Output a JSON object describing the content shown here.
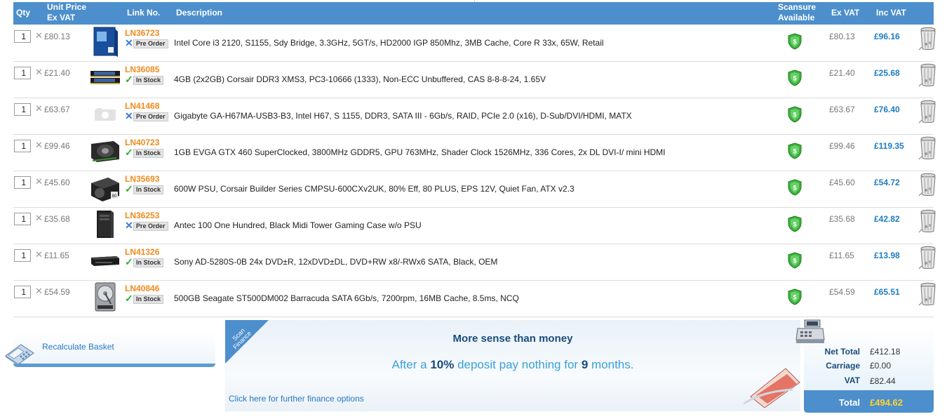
{
  "header": {
    "qty": "Qty",
    "unit_price_line1": "Unit Price",
    "unit_price_line2": "Ex VAT",
    "link_no": "Link No.",
    "description": "Description",
    "scansure_line1": "Scansure",
    "scansure_line2": "Available",
    "ex_vat": "Ex VAT",
    "inc_vat": "Inc VAT"
  },
  "items": [
    {
      "qty": "1",
      "unit_price": "£80.13",
      "link": "LN36723",
      "status": "Pre Order",
      "description": "Intel Core i3 2120, S1155, Sdy Bridge, 3.3GHz, 5GT/s, HD2000 IGP 850Mhz, 3MB Cache, Core R 33x, 65W, Retail",
      "ex_vat": "£80.13",
      "inc_vat": "£96.16",
      "thumb": "cpu-box"
    },
    {
      "qty": "1",
      "unit_price": "£21.40",
      "link": "LN36085",
      "status": "In Stock",
      "description": "4GB (2x2GB) Corsair DDR3 XMS3, PC3-10666 (1333), Non-ECC Unbuffered, CAS 8-8-8-24, 1.65V",
      "ex_vat": "£21.40",
      "inc_vat": "£25.68",
      "thumb": "ram"
    },
    {
      "qty": "1",
      "unit_price": "£63.67",
      "link": "LN41468",
      "status": "Pre Order",
      "description": "Gigabyte GA-H67MA-USB3-B3, Intel H67, S 1155, DDR3, SATA III - 6Gb/s, RAID, PCIe 2.0 (x16), D-Sub/DVI/HDMI, MATX",
      "ex_vat": "£63.67",
      "inc_vat": "£76.40",
      "thumb": "placeholder"
    },
    {
      "qty": "1",
      "unit_price": "£99.46",
      "link": "LN40723",
      "status": "In Stock",
      "description": "1GB EVGA GTX 460 SuperClocked, 3800MHz GDDR5, GPU 763MHz, Shader Clock 1526MHz, 336 Cores, 2x DL DVI-I/ mini HDMI",
      "ex_vat": "£99.46",
      "inc_vat": "£119.35",
      "thumb": "gpu"
    },
    {
      "qty": "1",
      "unit_price": "£45.60",
      "link": "LN35693",
      "status": "In Stock",
      "description": "600W PSU, Corsair Builder Series CMPSU-600CXv2UK, 80% Eff, 80 PLUS, EPS 12V, Quiet Fan, ATX v2.3",
      "ex_vat": "£45.60",
      "inc_vat": "£54.72",
      "thumb": "psu"
    },
    {
      "qty": "1",
      "unit_price": "£35.68",
      "link": "LN36253",
      "status": "Pre Order",
      "description": "Antec 100 One Hundred, Black Midi Tower Gaming Case w/o PSU",
      "ex_vat": "£35.68",
      "inc_vat": "£42.82",
      "thumb": "case"
    },
    {
      "qty": "1",
      "unit_price": "£11.65",
      "link": "LN41326",
      "status": "In Stock",
      "description": "Sony AD-5280S-0B 24x DVD±R, 12xDVD±DL, DVD+RW x8/-RWx6 SATA, Black, OEM",
      "ex_vat": "£11.65",
      "inc_vat": "£13.98",
      "thumb": "dvd"
    },
    {
      "qty": "1",
      "unit_price": "£54.59",
      "link": "LN40846",
      "status": "In Stock",
      "description": "500GB Seagate ST500DM002 Barracuda SATA 6Gb/s, 7200rpm, 16MB Cache, 8.5ms, NCQ",
      "ex_vat": "£54.59",
      "inc_vat": "£65.51",
      "thumb": "hdd"
    }
  ],
  "recalculate": {
    "label": "Recalculate Basket"
  },
  "finance": {
    "ribbon_line1": "Scan",
    "ribbon_line2": "Finance",
    "title": "More sense than money",
    "offer_prefix": "After a ",
    "offer_percent": "10%",
    "offer_middle": " deposit pay nothing for ",
    "offer_months": "9",
    "offer_suffix": " months.",
    "link": "Click here for further finance options"
  },
  "totals": {
    "net_total_label": "Net Total",
    "net_total": "£412.18",
    "carriage_label": "Carriage",
    "carriage": "£0.00",
    "vat_label": "VAT",
    "vat": "£82.44",
    "total_label": "Total",
    "total": "£494.62"
  },
  "colors": {
    "header": "#4d8fcc",
    "link": "#f08a1c",
    "inc_vat": "#1e7cc0",
    "in_stock": "#2eae2e",
    "pre_order": "#3a7bd5",
    "total_value": "#ffd42a"
  }
}
